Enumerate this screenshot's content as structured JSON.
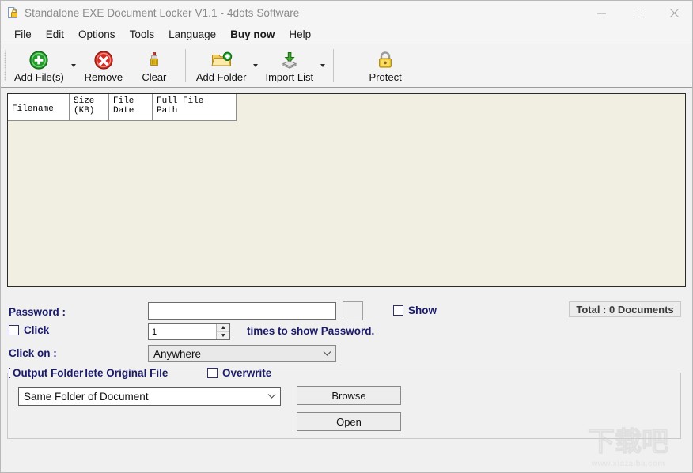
{
  "window": {
    "title": "Standalone EXE Document Locker V1.1 - 4dots Software",
    "icon": "document-lock-icon",
    "minimize_label": "minimize-icon",
    "maximize_label": "maximize-icon",
    "close_label": "close-icon"
  },
  "menu": [
    {
      "label": "File",
      "bold": false
    },
    {
      "label": "Edit",
      "bold": false
    },
    {
      "label": "Options",
      "bold": false
    },
    {
      "label": "Tools",
      "bold": false
    },
    {
      "label": "Language",
      "bold": false
    },
    {
      "label": "Buy now",
      "bold": true
    },
    {
      "label": "Help",
      "bold": false
    }
  ],
  "toolbar": [
    {
      "label": "Add File(s)",
      "icon": "add-file-icon",
      "caret": true
    },
    {
      "label": "Remove",
      "icon": "remove-icon",
      "caret": false
    },
    {
      "label": "Clear",
      "icon": "clear-brush-icon",
      "caret": false
    },
    {
      "label": "Add Folder",
      "icon": "add-folder-icon",
      "caret": true
    },
    {
      "label": "Import List",
      "icon": "import-list-icon",
      "caret": true
    },
    {
      "label": "Protect",
      "icon": "padlock-icon",
      "caret": false
    }
  ],
  "file_list": {
    "columns": [
      "Filename",
      "Size\n(KB)",
      "File\nDate",
      "Full File\nPath"
    ],
    "rows": []
  },
  "options": {
    "password_label": "Password :",
    "password_value": "",
    "password_placeholder": "",
    "show_label": "Show",
    "show_checked": false,
    "click_label": "Click",
    "click_checked": false,
    "click_times_value": "1",
    "times_label": "times to show Password.",
    "click_on_label": "Click on :",
    "click_on_value": "Anywhere",
    "securely_delete_label": "Securely Delete Original File",
    "securely_delete_checked": false,
    "overwrite_label": "Overwrite",
    "overwrite_checked": false,
    "total_label": "Total : 0 Documents"
  },
  "output": {
    "group_title": "Output Folder",
    "folder_value": "Same Folder of Document",
    "browse_label": "Browse",
    "open_label": "Open"
  },
  "watermark": {
    "text": "下载吧",
    "sub": "www.xiazaiba.com"
  },
  "colors": {
    "label_navy": "#1a1a6e",
    "list_bg": "#f0efe2",
    "window_bg": "#f0f0f0"
  }
}
